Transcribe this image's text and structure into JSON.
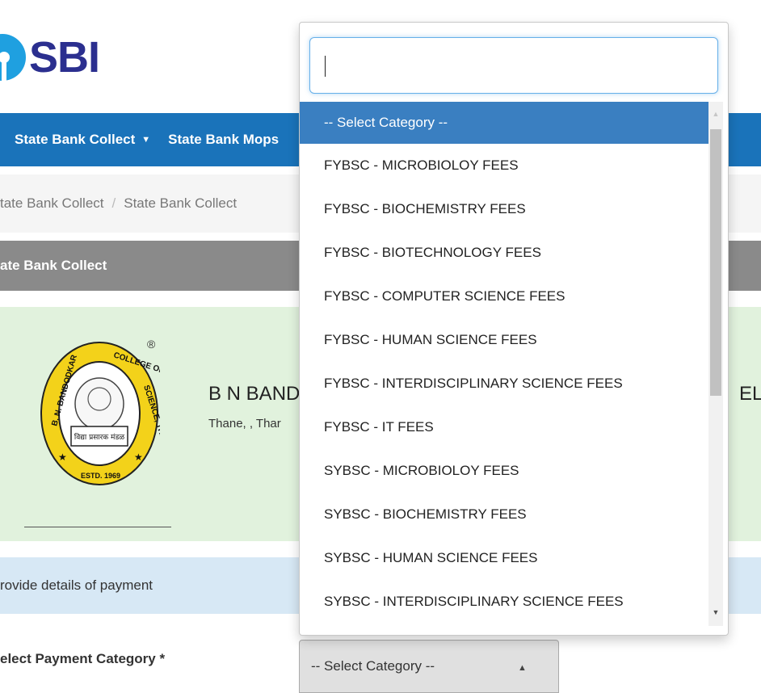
{
  "brand": {
    "logo_text": "SBI"
  },
  "nav": {
    "items": [
      {
        "label": "State Bank Collect",
        "has_caret": true
      },
      {
        "label": "State Bank Mops"
      }
    ]
  },
  "breadcrumb": {
    "items": [
      "tate Bank Collect",
      "State Bank Collect"
    ],
    "separator": "/"
  },
  "section": {
    "title": "ate Bank Collect"
  },
  "college": {
    "name": "B N BAND",
    "name_right": "ELF",
    "address": "Thane, , Thar",
    "registered_mark": "®",
    "seal": {
      "top_text": "COLLEGE OF",
      "left_text": "B. N. BANDODKAR",
      "right_text": "SCIENCE, THANE",
      "bottom_text": "ESTD. 1969",
      "banner_text": "विद्या प्रसारक मंडळ"
    }
  },
  "info_bar": {
    "text": "rovide details of payment"
  },
  "form": {
    "label": "elect Payment Category *",
    "select_value": "-- Select Category --"
  },
  "dropdown": {
    "search_value": "",
    "options": [
      "-- Select Category --",
      "FYBSC - MICROBIOLOY FEES",
      "FYBSC - BIOCHEMISTRY FEES",
      "FYBSC - BIOTECHNOLOGY FEES",
      "FYBSC - COMPUTER SCIENCE FEES",
      "FYBSC - HUMAN SCIENCE FEES",
      "FYBSC - INTERDISCIPLINARY SCIENCE FEES",
      "FYBSC - IT FEES",
      "SYBSC - MICROBIOLOY FEES",
      "SYBSC - BIOCHEMISTRY FEES",
      "SYBSC - HUMAN SCIENCE FEES",
      "SYBSC - INTERDISCIPLINARY SCIENCE FEES"
    ],
    "selected_index": 0
  },
  "colors": {
    "nav_bg": "#1a73ba",
    "selected_option_bg": "#3a7fc1",
    "college_panel_bg": "#e1f2dd",
    "info_bar_bg": "#d7e8f5",
    "logo_text": "#2b2f8f",
    "logo_mark": "#1fa0e0"
  }
}
